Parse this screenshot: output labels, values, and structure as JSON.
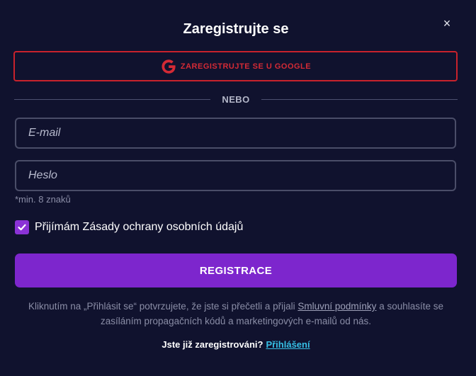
{
  "modal": {
    "title": "Zaregistrujte se",
    "close_icon": "×"
  },
  "google_button": {
    "label": "ZAREGISTRUJTE SE U GOOGLE",
    "icon": "google-g-icon",
    "border_color": "#c8222c"
  },
  "divider": {
    "text": "NEBO"
  },
  "email_field": {
    "placeholder": "E-mail",
    "value": ""
  },
  "password_field": {
    "placeholder": "Heslo",
    "value": ""
  },
  "password_hint": "*min. 8 znaků",
  "consent": {
    "checked": true,
    "label": "Přijímám Zásady ochrany osobních údajů"
  },
  "register_button": {
    "label": "REGISTRACE",
    "color": "#7d26cd"
  },
  "legal": {
    "text_before": "Kliknutím na „Přihlásit se“ potvrzujete, že jste si přečetli a přijali ",
    "terms_link": "Smluvní podmínky",
    "text_after": " a souhlasíte se zasíláním propagačních kódů a marketingových e-mailů od nás."
  },
  "login_prompt": {
    "text": "Jste již zaregistrováni?",
    "link": "Přihlášení",
    "link_color": "#36c0e6"
  }
}
